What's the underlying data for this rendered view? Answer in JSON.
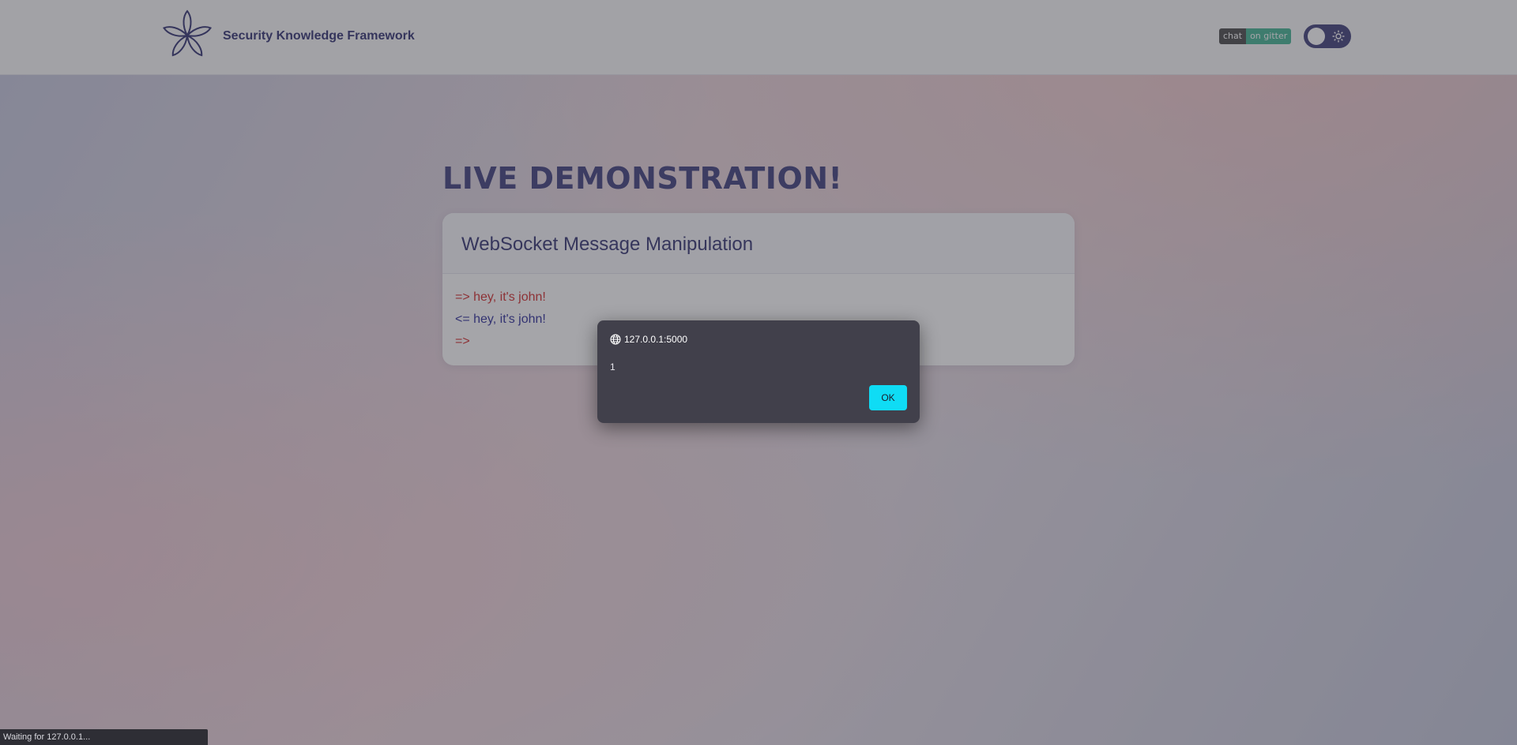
{
  "header": {
    "brand": "Security Knowledge Framework",
    "gitter_badge": {
      "left": "chat",
      "right": "on gitter"
    },
    "theme_toggle_icon": "sun-icon"
  },
  "main": {
    "title": "LIVE DEMONSTRATION!",
    "card": {
      "title": "WebSocket Message Manipulation",
      "messages": [
        {
          "direction": "out",
          "text": "=> hey, it's john!"
        },
        {
          "direction": "in",
          "text": "<= hey, it's john!"
        },
        {
          "direction": "out",
          "text": "=>"
        }
      ]
    }
  },
  "dialog": {
    "origin": "127.0.0.1:5000",
    "message": "1",
    "ok_label": "OK"
  },
  "status_bar": {
    "text": "Waiting for 127.0.0.1..."
  },
  "colors": {
    "accent": "#4a4a85",
    "ok_button": "#0fdcf5",
    "outgoing": "#d63a3a",
    "incoming": "#3b3ba0"
  }
}
